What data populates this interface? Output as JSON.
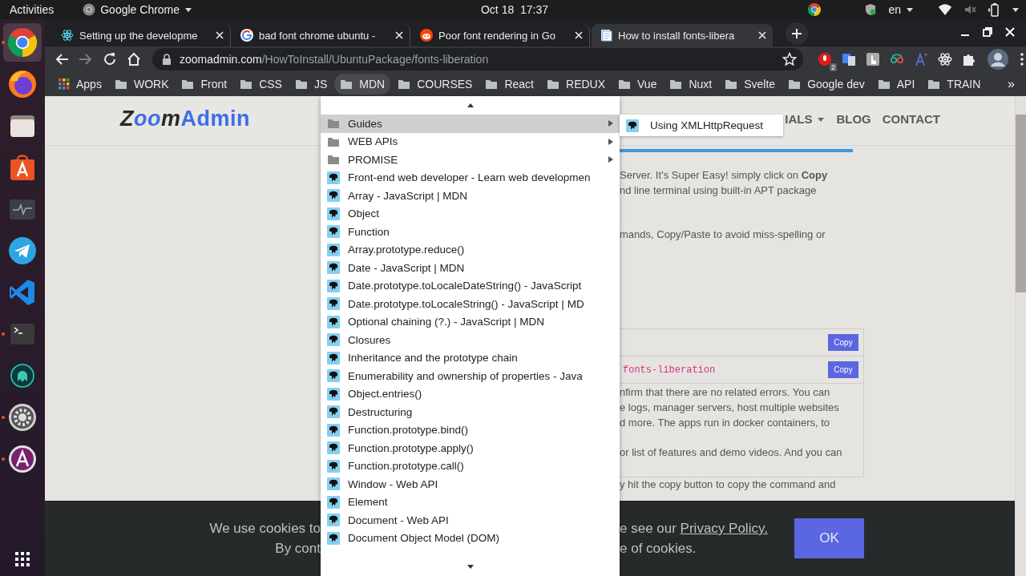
{
  "top_bar": {
    "activities": "Activities",
    "app_name": "Google Chrome",
    "clock": "Oct 18  17:37",
    "language": "en"
  },
  "dock": [
    {
      "kind": "chrome",
      "selected": true,
      "running": true
    },
    {
      "kind": "firefox",
      "selected": false,
      "running": false
    },
    {
      "kind": "files",
      "selected": false,
      "running": false
    },
    {
      "kind": "software",
      "selected": false,
      "running": false
    },
    {
      "kind": "monitor",
      "selected": false,
      "running": false
    },
    {
      "kind": "telegram",
      "selected": false,
      "running": false
    },
    {
      "kind": "vscode",
      "selected": false,
      "running": false
    },
    {
      "kind": "terminal",
      "selected": false,
      "running": true
    },
    {
      "kind": "gitkraken",
      "selected": false,
      "running": false
    },
    {
      "kind": "settings",
      "selected": false,
      "running": true
    },
    {
      "kind": "assistant",
      "selected": false,
      "running": true
    }
  ],
  "tabs": [
    {
      "kind": "react",
      "title": "Setting up the developme",
      "selected": false
    },
    {
      "kind": "google",
      "title": "bad font chrome ubuntu -",
      "selected": false
    },
    {
      "kind": "reddit",
      "title": "Poor font rendering in Go",
      "selected": false
    },
    {
      "kind": "document",
      "title": "How to install fonts-libera",
      "selected": true
    }
  ],
  "toolbar": {
    "nav": [
      {
        "kind": "back",
        "disabled": false
      },
      {
        "kind": "forward",
        "disabled": true
      },
      {
        "kind": "reload",
        "disabled": false
      },
      {
        "kind": "home",
        "disabled": false
      }
    ],
    "url_host": "zoomadmin.com",
    "url_path": "/HowToInstall/UbuntuPackage/fonts-liberation",
    "extensions": [
      {
        "kind": "record",
        "badge": "2"
      },
      {
        "kind": "translate"
      },
      {
        "kind": "hand"
      },
      {
        "kind": "glasses"
      },
      {
        "kind": "font"
      },
      {
        "kind": "atom"
      },
      {
        "kind": "puzzle"
      }
    ]
  },
  "bookmarks": {
    "items": [
      {
        "kind": "apps",
        "label": "Apps",
        "selected": false
      },
      {
        "kind": "folder",
        "label": "WORK",
        "selected": false
      },
      {
        "kind": "folder",
        "label": "Front",
        "selected": false
      },
      {
        "kind": "folder",
        "label": "CSS",
        "selected": false
      },
      {
        "kind": "folder",
        "label": "JS",
        "selected": false
      },
      {
        "kind": "folder",
        "label": "MDN",
        "selected": true
      },
      {
        "kind": "folder",
        "label": "COURSES",
        "selected": false
      },
      {
        "kind": "folder",
        "label": "React",
        "selected": false
      },
      {
        "kind": "folder",
        "label": "REDUX",
        "selected": false
      },
      {
        "kind": "folder",
        "label": "Vue",
        "selected": false
      },
      {
        "kind": "folder",
        "label": "Nuxt",
        "selected": false
      },
      {
        "kind": "folder",
        "label": "Svelte",
        "selected": false
      },
      {
        "kind": "folder",
        "label": "Google dev",
        "selected": false
      },
      {
        "kind": "folder",
        "label": "API",
        "selected": false
      },
      {
        "kind": "folder",
        "label": "TRAIN",
        "selected": false
      }
    ],
    "overflow": "»"
  },
  "page": {
    "logo": [
      "Z",
      "oo",
      "m",
      "Admin"
    ],
    "nav": [
      {
        "label": "IALS",
        "dropdown": true
      },
      {
        "label": "BLOG",
        "dropdown": false
      },
      {
        "label": "CONTACT",
        "dropdown": false
      }
    ],
    "intro": [
      "Server. It’s Super Easy! simply click on **Copy**",
      "nd line terminal using built-in APT package"
    ],
    "note": "mands, Copy/Paste to avoid miss-spelling or",
    "commands": [
      {
        "button": "Copy"
      },
      {
        "code": "fonts-liberation",
        "button": "Copy"
      }
    ],
    "box_text": [
      [
        "nfirm that there are no related errors. You can",
        "e logs, manager servers, host multiple websites",
        "d more. The apps run in docker containers, to"
      ],
      [
        "or list of features and demo videos. And you can"
      ]
    ],
    "after": "y hit the copy button to copy the command and"
  },
  "cookie_bar": {
    "left": [
      "We use cookies to",
      "By cont"
    ],
    "right": [
      {
        "text": "e see our",
        "link": "Privacy Policy."
      },
      {
        "text": "e of cookies."
      }
    ],
    "button": "OK"
  },
  "menu": {
    "items": [
      {
        "kind": "folder",
        "label": "Guides",
        "selected": true
      },
      {
        "kind": "folder",
        "label": "WEB APIs",
        "selected": false
      },
      {
        "kind": "folder",
        "label": "PROMISE",
        "selected": false
      },
      {
        "kind": "bookmark",
        "label": "Front-end web developer - Learn web developmen",
        "selected": false
      },
      {
        "kind": "bookmark",
        "label": "Array - JavaScript | MDN",
        "selected": false
      },
      {
        "kind": "bookmark",
        "label": "Object",
        "selected": false
      },
      {
        "kind": "bookmark",
        "label": "Function",
        "selected": false
      },
      {
        "kind": "bookmark",
        "label": "Array.prototype.reduce()",
        "selected": false
      },
      {
        "kind": "bookmark",
        "label": "Date - JavaScript | MDN",
        "selected": false
      },
      {
        "kind": "bookmark",
        "label": "Date.prototype.toLocaleDateString() - JavaScript",
        "selected": false
      },
      {
        "kind": "bookmark",
        "label": "Date.prototype.toLocaleString() - JavaScript | MD",
        "selected": false
      },
      {
        "kind": "bookmark",
        "label": "Optional chaining (?.) - JavaScript | MDN",
        "selected": false
      },
      {
        "kind": "bookmark",
        "label": "Closures",
        "selected": false
      },
      {
        "kind": "bookmark",
        "label": "Inheritance and the prototype chain",
        "selected": false
      },
      {
        "kind": "bookmark",
        "label": "Enumerability and ownership of properties - Java",
        "selected": false
      },
      {
        "kind": "bookmark",
        "label": "Object.entries()",
        "selected": false
      },
      {
        "kind": "bookmark",
        "label": "Destructuring",
        "selected": false
      },
      {
        "kind": "bookmark",
        "label": "Function.prototype.bind()",
        "selected": false
      },
      {
        "kind": "bookmark",
        "label": "Function.prototype.apply()",
        "selected": false
      },
      {
        "kind": "bookmark",
        "label": "Function.prototype.call()",
        "selected": false
      },
      {
        "kind": "bookmark",
        "label": "Window - Web API",
        "selected": false
      },
      {
        "kind": "bookmark",
        "label": "Element",
        "selected": false
      },
      {
        "kind": "bookmark",
        "label": "Document - Web API",
        "selected": false
      },
      {
        "kind": "bookmark",
        "label": "Document Object Model (DOM)",
        "selected": false
      }
    ]
  },
  "submenu": {
    "items": [
      {
        "kind": "bookmark",
        "label": "Using XMLHttpRequest",
        "selected": false
      }
    ]
  }
}
